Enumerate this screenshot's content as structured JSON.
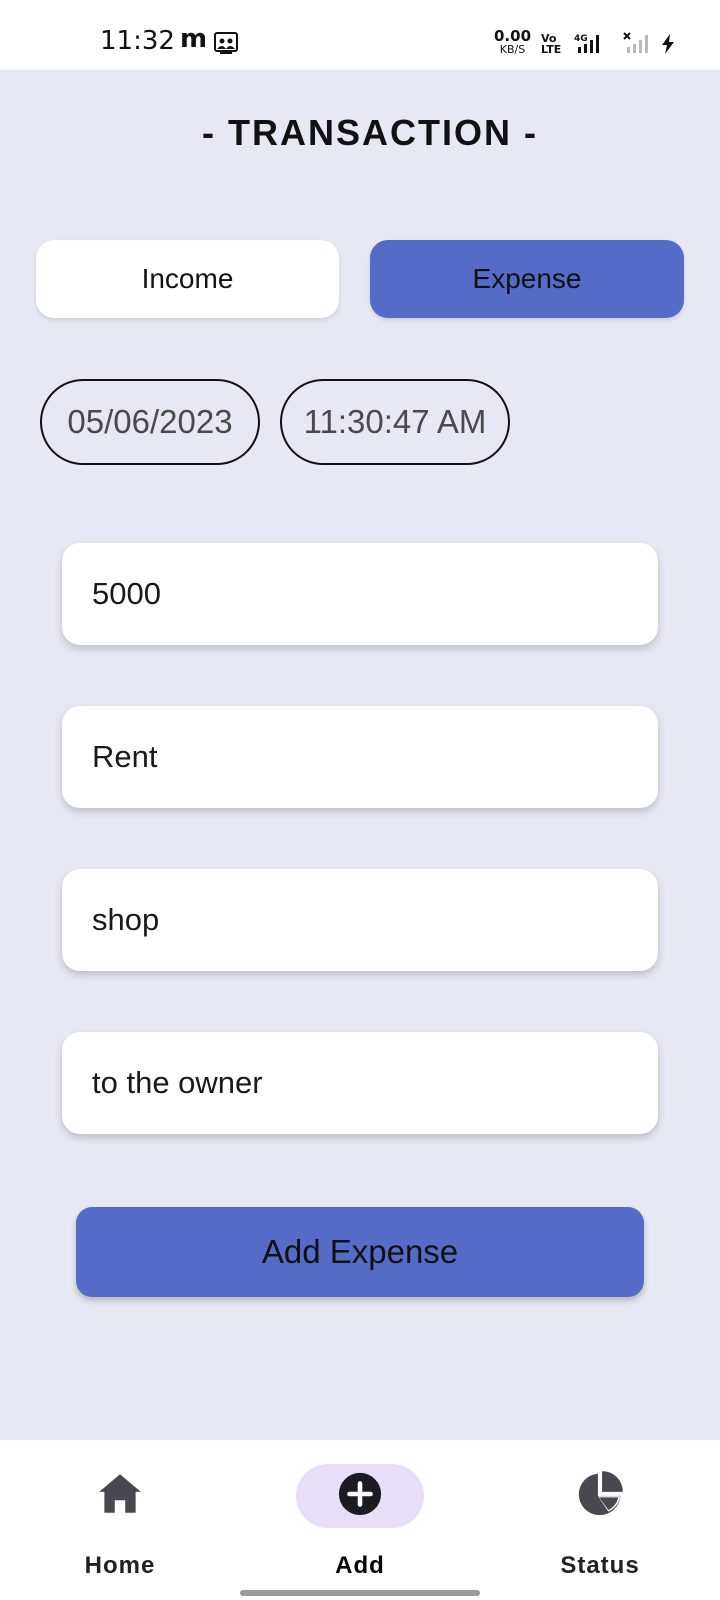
{
  "status_bar": {
    "time": "11:32",
    "app_letter": "m",
    "net_speed": "0.00",
    "net_unit": "KB/S",
    "volte_line1": "Vo",
    "volte_line2": "LTE",
    "network_type": "4G",
    "icons": [
      "m-app-icon",
      "people-card-icon",
      "signal-4g-icon",
      "signal-no-service-icon",
      "charging-bolt-icon"
    ]
  },
  "header": {
    "title": "- TRANSACTION -"
  },
  "type_toggle": {
    "income_label": "Income",
    "expense_label": "Expense",
    "selected": "Expense"
  },
  "datetime": {
    "date": "05/06/2023",
    "time": "11:30:47 AM"
  },
  "form": {
    "amount": "5000",
    "category": "Rent",
    "place": "shop",
    "note": "to the owner"
  },
  "submit": {
    "label": "Add Expense"
  },
  "bottom_nav": {
    "items": [
      {
        "label": "Home",
        "icon": "home-icon"
      },
      {
        "label": "Add",
        "icon": "add-circle-icon",
        "active": true
      },
      {
        "label": "Status",
        "icon": "pie-chart-icon"
      }
    ]
  },
  "colors": {
    "background": "#E6E8F4",
    "accent": "#546BC8",
    "nav_active_pill": "#E8DEF8"
  }
}
